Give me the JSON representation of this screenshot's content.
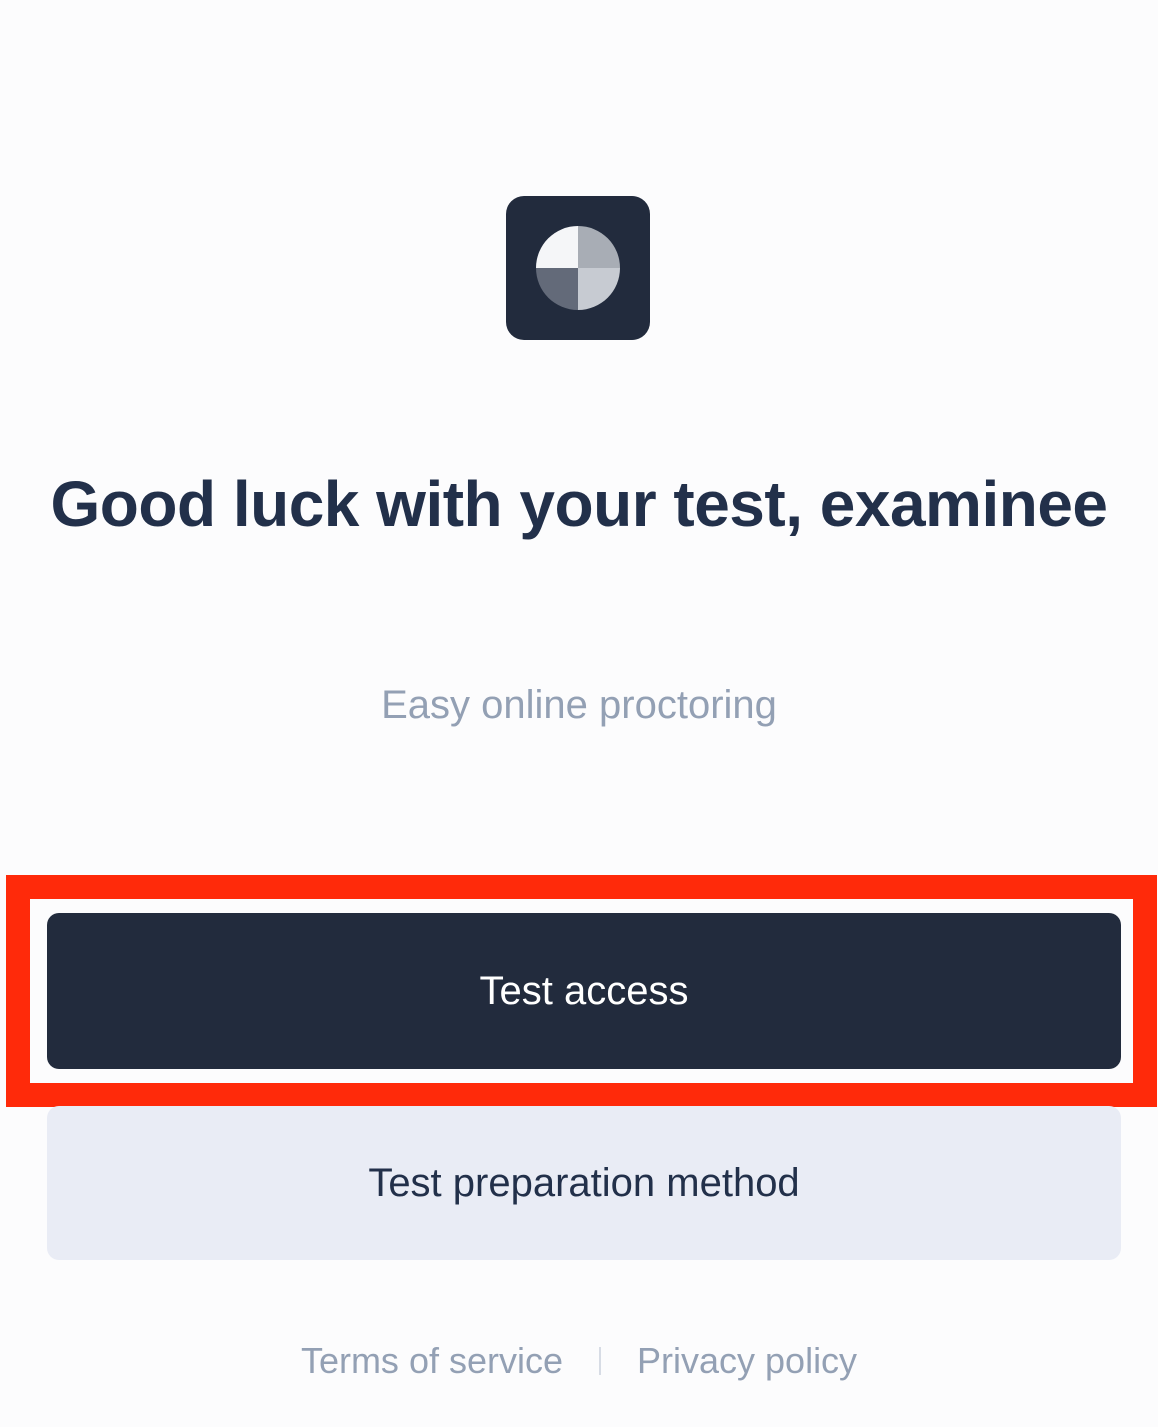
{
  "logo": {
    "icon": "pie-chart-logo-icon",
    "background_color": "#222b3d",
    "quadrant_colors": [
      "#f5f6f8",
      "#a8adb5",
      "#636a79",
      "#c7cbd2"
    ]
  },
  "headline": "Good luck with your test, examinee",
  "subtitle": "Easy online proctoring",
  "buttons": {
    "test_access": "Test access",
    "test_preparation": "Test preparation method"
  },
  "footer": {
    "terms": "Terms of service",
    "privacy": "Privacy policy"
  },
  "colors": {
    "primary": "#222b3d",
    "secondary_button_bg": "#e9ecf5",
    "muted_text": "#93a0b4",
    "highlight": "#ff2a0a"
  }
}
